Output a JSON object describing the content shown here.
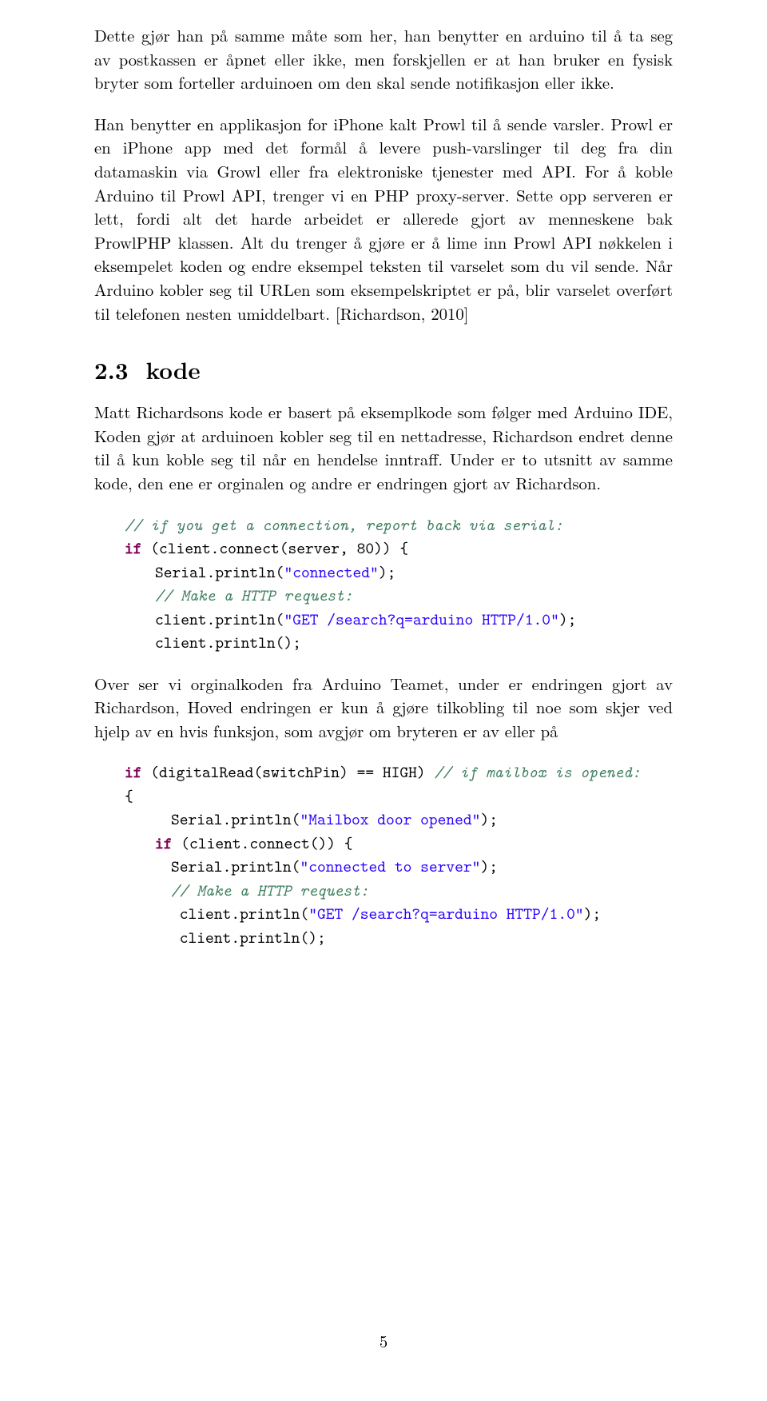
{
  "para1": "Dette gjør han på samme måte som her, han benytter en arduino til å ta seg av postkassen er åpnet eller ikke, men forskjellen er at han bruker en fysisk bryter som forteller arduinoen om den skal sende notifikasjon eller ikke.",
  "para2": "Han benytter en applikasjon for iPhone kalt Prowl til å sende varsler. Prowl er en iPhone app med det formål å levere push-varslinger til deg fra din datamaskin via Growl eller fra elektroniske tjenester med API. For å koble Arduino til Prowl API, trenger vi en PHP proxy-server. Sette opp serveren er lett, fordi alt det harde arbeidet er allerede gjort av menneskene bak ProwlPHP klassen. Alt du trenger å gjøre er å lime inn Prowl API nøkkelen i eksempelet koden og endre eksempel teksten til varselet som du vil sende. Når Arduino kobler seg til URLen som eksempelskriptet er på, blir varselet overført til telefonen nesten umiddelbart. [Richardson, 2010]",
  "section": {
    "number": "2.3",
    "title": "kode"
  },
  "para3": "Matt Richardsons kode er basert på eksemplkode som følger med Arduino IDE, Koden gjør at arduinoen kobler seg til en nettadresse, Richardson endret denne til å kun koble seg til når en hendelse inntraff. Under er to utsnitt av samme kode, den ene er orginalen og andre er endringen gjort av Richardson.",
  "code1": {
    "c1": "// if you get a connection, report back via serial:",
    "l2a": "if",
    "l2b": " (client.connect(server, 80)) {",
    "l3a": "Serial.println(",
    "l3b": "\"connected\"",
    "l3c": ");",
    "c4": "// Make a HTTP request:",
    "l5a": "client.println(",
    "l5b": "\"GET /search?q=arduino HTTP/1.0\"",
    "l5c": ");",
    "l6": "client.println();"
  },
  "para4": "Over ser vi orginalkoden fra Arduino Teamet, under er endringen gjort av Richardson, Hoved endringen er kun å gjøre tilkobling til noe som skjer ved hjelp av en hvis funksjon, som avgjør om bryteren er av eller på",
  "code2": {
    "l1a": "if",
    "l1b": " (digitalRead(switchPin) == HIGH) ",
    "c1": "// if mailbox is opened:",
    "l2": "{",
    "l3a": "Serial.println(",
    "l3b": "\"Mailbox door opened\"",
    "l3c": ");",
    "l4a": "if",
    "l4b": " (client.connect()) {",
    "l5a": "Serial.println(",
    "l5b": "\"connected to server\"",
    "l5c": ");",
    "c6": "// Make a HTTP request:",
    "l7a": "client.println(",
    "l7b": "\"GET /search?q=arduino HTTP/1.0\"",
    "l7c": ");",
    "l8": "client.println();"
  },
  "pagenum": "5"
}
